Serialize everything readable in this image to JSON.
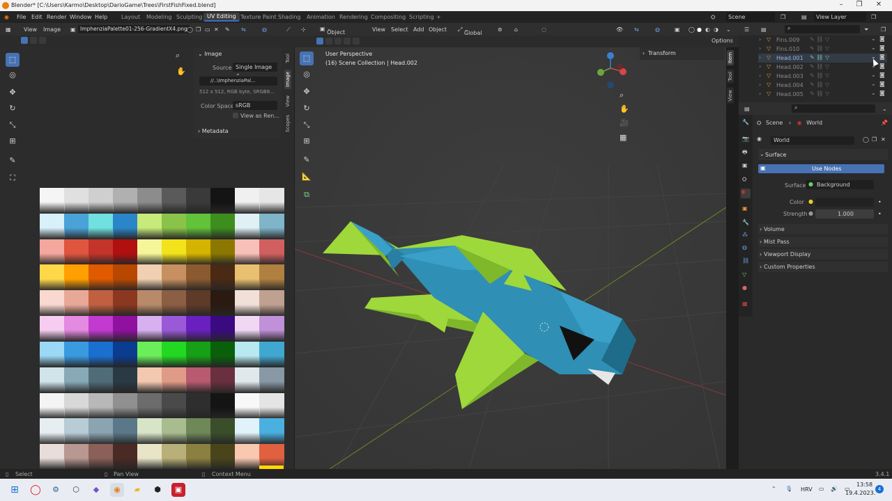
{
  "window": {
    "title": "Blender* [C:\\Users\\Karmo\\Desktop\\DarioGame\\Trees\\FirstFishFixed.blend]"
  },
  "menus": [
    "File",
    "Edit",
    "Render",
    "Window",
    "Help"
  ],
  "workspaces": [
    "Layout",
    "Modeling",
    "Sculpting",
    "UV Editing",
    "Texture Paint",
    "Shading",
    "Animation",
    "Rendering",
    "Compositing",
    "Scripting"
  ],
  "active_workspace": "UV Editing",
  "scene": {
    "name": "Scene",
    "view_layer": "View Layer"
  },
  "image_editor": {
    "menus": [
      "View",
      "Image"
    ],
    "image_name": "ImphenziaPalette01-256-GradientX4.png",
    "panel_title": "Image",
    "source_label": "Source",
    "source_value": "Single Image",
    "filepath": "//..\\ImphenziaPal...",
    "info": "512 x 512, RGB byte, SRGB8...",
    "colorspace_label": "Color Space",
    "colorspace_value": "sRGB",
    "view_as_render": "View as Ren...",
    "metadata": "Metadata",
    "tabs": [
      "Tool",
      "Image",
      "View",
      "Scopes"
    ]
  },
  "viewport": {
    "mode": "Object Mode",
    "menus": [
      "View",
      "Select",
      "Add",
      "Object"
    ],
    "orientation": "Global",
    "options": "Options",
    "overlay_line1": "User Perspective",
    "overlay_line2": "(16) Scene Collection | Head.002",
    "transform": "Transform",
    "tabs": [
      "Item",
      "Tool",
      "View"
    ]
  },
  "outliner": {
    "items": [
      {
        "name": "Fins.009",
        "selected": false
      },
      {
        "name": "Fins.010",
        "selected": false
      },
      {
        "name": "Head.001",
        "selected": true
      },
      {
        "name": "Head.002",
        "selected": false
      },
      {
        "name": "Head.003",
        "selected": false
      },
      {
        "name": "Head.004",
        "selected": false
      },
      {
        "name": "Head.005",
        "selected": false
      }
    ]
  },
  "properties": {
    "breadcrumb": [
      "Scene",
      "World"
    ],
    "world_name": "World",
    "surface_panel": "Surface",
    "use_nodes": "Use Nodes",
    "surface_label": "Surface",
    "surface_value": "Background",
    "color_label": "Color",
    "strength_label": "Strength",
    "strength_value": "1.000",
    "collapsed_panels": [
      "Volume",
      "Mist Pass",
      "Viewport Display",
      "Custom Properties"
    ]
  },
  "statusbar": {
    "select": "Select",
    "pan": "Pan View",
    "context": "Context Menu",
    "version": "3.4.1"
  },
  "taskbar": {
    "lang": "HRV",
    "time": "13:58",
    "date": "19.4.2023.",
    "notif": "4"
  },
  "colors": {
    "accent": "#4772b3",
    "fish_body": "#2f8fb5",
    "fish_fins": "#9fd83a",
    "bg": "#303030"
  }
}
